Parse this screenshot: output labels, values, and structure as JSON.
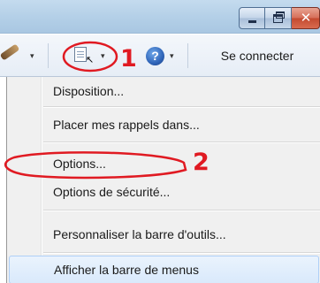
{
  "window": {
    "caption_buttons": {
      "minimize_icon": "minimize-icon",
      "restore_icon": "restore-icon",
      "close_symbol": "✕"
    }
  },
  "toolbar": {
    "dropdown_arrow": "▾",
    "help_symbol": "?",
    "connect_label": "Se connecter"
  },
  "menu": {
    "items": [
      {
        "label": "Disposition..."
      },
      {
        "label": "Placer mes rappels dans..."
      },
      {
        "label": "Options..."
      },
      {
        "label": "Options de sécurité..."
      },
      {
        "label": "Personnaliser la barre d'outils..."
      },
      {
        "label": "Afficher la barre de menus"
      }
    ],
    "hovered_item": "Afficher la barre de menus"
  },
  "annotations": {
    "step1": "1",
    "step2": "2",
    "color": "#e01a22"
  }
}
